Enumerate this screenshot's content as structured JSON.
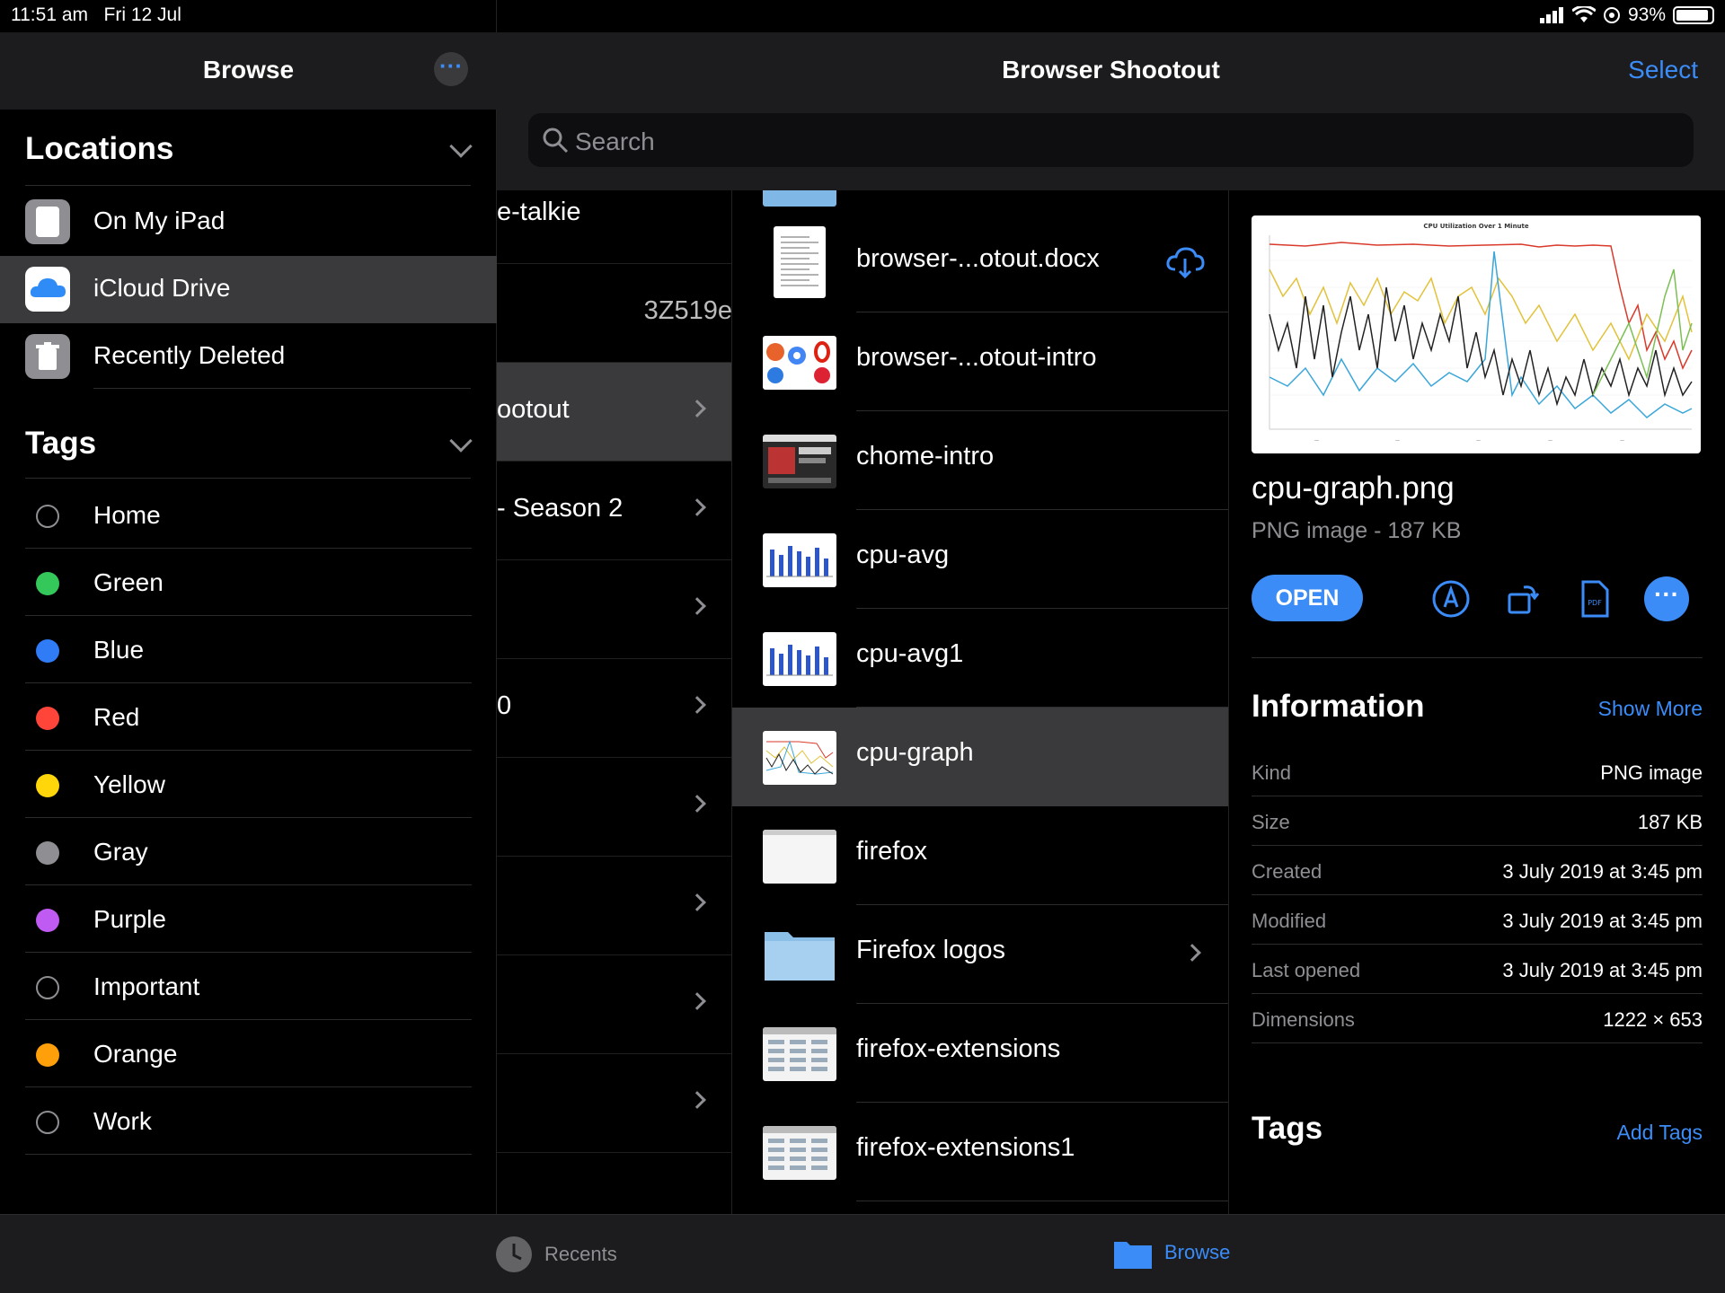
{
  "status_bar": {
    "time": "11:51 am",
    "date": "Fri 12 Jul",
    "battery": "93%",
    "battery_level": 0.93
  },
  "sidebar": {
    "title": "Browse",
    "locations_title": "Locations",
    "locations": [
      {
        "label": "On My iPad",
        "icon": "ipad-icon"
      },
      {
        "label": "iCloud Drive",
        "icon": "icloud-icon",
        "selected": true
      },
      {
        "label": "Recently Deleted",
        "icon": "trash-icon"
      }
    ],
    "tags_title": "Tags",
    "tags": [
      {
        "label": "Home",
        "color": ""
      },
      {
        "label": "Green",
        "color": "#34c759"
      },
      {
        "label": "Blue",
        "color": "#2f7cf6"
      },
      {
        "label": "Red",
        "color": "#ff453a"
      },
      {
        "label": "Yellow",
        "color": "#ffd60a"
      },
      {
        "label": "Gray",
        "color": "#8e8e93"
      },
      {
        "label": "Purple",
        "color": "#bf5af2"
      },
      {
        "label": "Important",
        "color": ""
      },
      {
        "label": "Orange",
        "color": "#ff9f0a"
      },
      {
        "label": "Work",
        "color": ""
      }
    ]
  },
  "header": {
    "title": "Browser Shootout",
    "select_label": "Select"
  },
  "search": {
    "placeholder": "Search"
  },
  "column1": {
    "rows": [
      {
        "text": "e-talkie",
        "chevron": false
      },
      {
        "text": "3Z519e",
        "chevron": false
      },
      {
        "text": "ootout",
        "chevron": true,
        "selected": true
      },
      {
        "text": "- Season 2",
        "chevron": true
      },
      {
        "text": "",
        "chevron": true
      },
      {
        "text": "0",
        "chevron": true
      },
      {
        "text": "",
        "chevron": true
      },
      {
        "text": "",
        "chevron": true
      },
      {
        "text": "",
        "chevron": true
      },
      {
        "text": "",
        "chevron": true
      }
    ]
  },
  "column2": {
    "files": [
      {
        "name": "browser-...otout.docx",
        "thumb": "doc",
        "cloud": true
      },
      {
        "name": "browser-...otout-intro",
        "thumb": "logos"
      },
      {
        "name": "chome-intro",
        "thumb": "web"
      },
      {
        "name": "cpu-avg",
        "thumb": "bars"
      },
      {
        "name": "cpu-avg1",
        "thumb": "bars"
      },
      {
        "name": "cpu-graph",
        "thumb": "graph",
        "selected": true
      },
      {
        "name": "firefox",
        "thumb": "blank"
      },
      {
        "name": "Firefox logos",
        "thumb": "folder",
        "chevron": true
      },
      {
        "name": "firefox-extensions",
        "thumb": "web2"
      },
      {
        "name": "firefox-extensions1",
        "thumb": "web2"
      }
    ]
  },
  "detail": {
    "file_name": "cpu-graph.png",
    "file_sub": "PNG image - 187 KB",
    "open_label": "OPEN",
    "info_title": "Information",
    "show_more": "Show More",
    "info": [
      {
        "key": "Kind",
        "value": "PNG image"
      },
      {
        "key": "Size",
        "value": "187 KB"
      },
      {
        "key": "Created",
        "value": "3 July 2019 at 3:45 pm"
      },
      {
        "key": "Modified",
        "value": "3 July 2019 at 3:45 pm"
      },
      {
        "key": "Last opened",
        "value": "3 July 2019 at 3:45 pm"
      },
      {
        "key": "Dimensions",
        "value": "1222 × 653"
      }
    ],
    "tags_title": "Tags",
    "add_tags": "Add Tags",
    "preview_title": "CPU Utilization Over 1 Minute"
  },
  "tabbar": {
    "recents": "Recents",
    "browse": "Browse"
  },
  "colors": {
    "accent": "#3b8cf7",
    "selected_row": "#3a3a3c"
  }
}
